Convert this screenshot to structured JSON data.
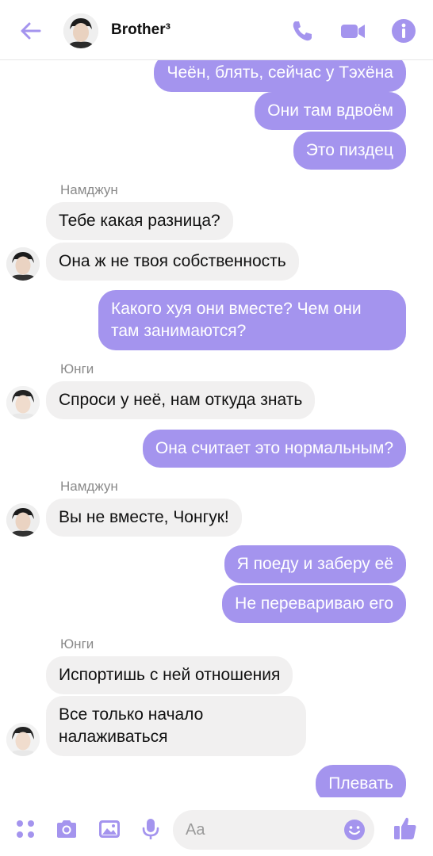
{
  "header": {
    "title": "Brother³",
    "back_icon": "arrow-left-icon",
    "call_icon": "phone-icon",
    "video_icon": "video-camera-icon",
    "info_icon": "info-icon",
    "accent": "#a494ee"
  },
  "messages": [
    {
      "side": "out",
      "text": "Чеён, блять, сейчас у Тэхёна"
    },
    {
      "side": "out",
      "text": "Они там вдвоём"
    },
    {
      "side": "out",
      "text": "Это пиздец"
    },
    {
      "side": "in",
      "sender": "Намджун",
      "text": "Тебе какая разница?"
    },
    {
      "side": "in",
      "text": "Она ж не твоя собственность"
    },
    {
      "side": "out",
      "text": "Какого хуя они вместе? Чем они там занимаются?"
    },
    {
      "side": "in",
      "sender": "Юнги",
      "text": "Спроси у неё, нам откуда знать"
    },
    {
      "side": "out",
      "text": "Она считает это нормальным?"
    },
    {
      "side": "in",
      "sender": "Намджун",
      "text": "Вы не вместе, Чонгук!"
    },
    {
      "side": "out",
      "text": "Я поеду и заберу её"
    },
    {
      "side": "out",
      "text": "Не перевариваю его"
    },
    {
      "side": "in",
      "sender": "Юнги",
      "text": "Испортишь с ней отношения"
    },
    {
      "side": "in",
      "text": "Все только начало налаживаться"
    },
    {
      "side": "out",
      "text": "Плевать"
    }
  ],
  "composer": {
    "placeholder": "Aa",
    "icons": [
      "grid-dots-icon",
      "camera-icon",
      "image-icon",
      "microphone-icon",
      "emoji-icon",
      "thumbs-up-icon"
    ]
  }
}
